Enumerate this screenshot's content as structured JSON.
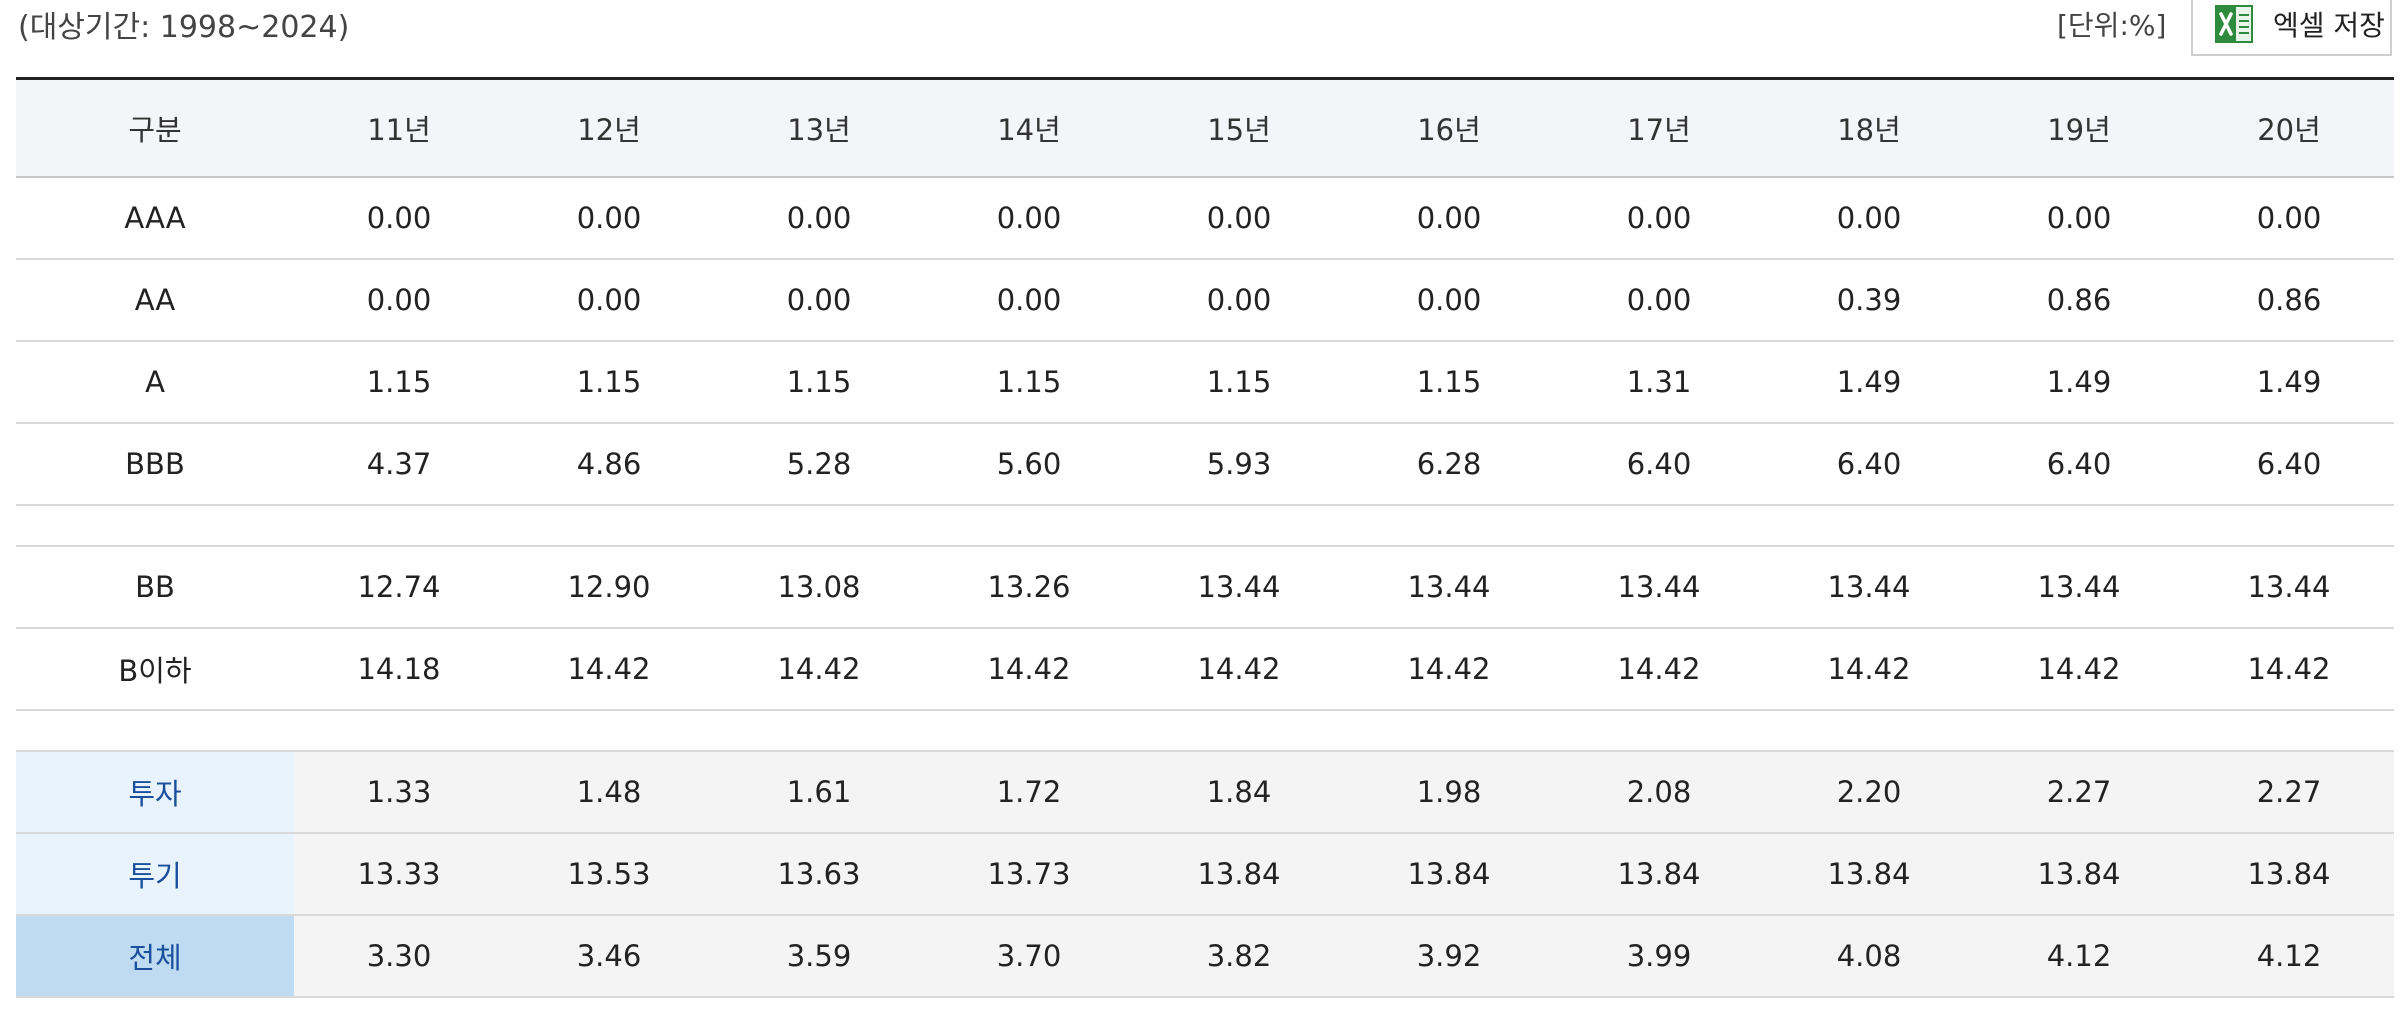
{
  "header": {
    "period": "(대상기간: 1998~2024)",
    "unit": "[단위:%]",
    "excel_label": "엑셀 저장",
    "excel_icon": "excel-icon"
  },
  "table": {
    "columns": [
      "구분",
      "11년",
      "12년",
      "13년",
      "14년",
      "15년",
      "16년",
      "17년",
      "18년",
      "19년",
      "20년"
    ],
    "rows": [
      {
        "label": "AAA",
        "values": [
          "0.00",
          "0.00",
          "0.00",
          "0.00",
          "0.00",
          "0.00",
          "0.00",
          "0.00",
          "0.00",
          "0.00"
        ]
      },
      {
        "label": "AA",
        "values": [
          "0.00",
          "0.00",
          "0.00",
          "0.00",
          "0.00",
          "0.00",
          "0.00",
          "0.39",
          "0.86",
          "0.86"
        ]
      },
      {
        "label": "A",
        "values": [
          "1.15",
          "1.15",
          "1.15",
          "1.15",
          "1.15",
          "1.15",
          "1.31",
          "1.49",
          "1.49",
          "1.49"
        ]
      },
      {
        "label": "BBB",
        "values": [
          "4.37",
          "4.86",
          "5.28",
          "5.60",
          "5.93",
          "6.28",
          "6.40",
          "6.40",
          "6.40",
          "6.40"
        ]
      },
      {
        "label": "BB",
        "values": [
          "12.74",
          "12.90",
          "13.08",
          "13.26",
          "13.44",
          "13.44",
          "13.44",
          "13.44",
          "13.44",
          "13.44"
        ]
      },
      {
        "label": "B이하",
        "values": [
          "14.18",
          "14.42",
          "14.42",
          "14.42",
          "14.42",
          "14.42",
          "14.42",
          "14.42",
          "14.42",
          "14.42"
        ]
      },
      {
        "label": "투자",
        "values": [
          "1.33",
          "1.48",
          "1.61",
          "1.72",
          "1.84",
          "1.98",
          "2.08",
          "2.20",
          "2.27",
          "2.27"
        ]
      },
      {
        "label": "투기",
        "values": [
          "13.33",
          "13.53",
          "13.63",
          "13.73",
          "13.84",
          "13.84",
          "13.84",
          "13.84",
          "13.84",
          "13.84"
        ]
      },
      {
        "label": "전체",
        "values": [
          "3.30",
          "3.46",
          "3.59",
          "3.70",
          "3.82",
          "3.92",
          "3.99",
          "4.08",
          "4.12",
          "4.12"
        ]
      }
    ]
  }
}
